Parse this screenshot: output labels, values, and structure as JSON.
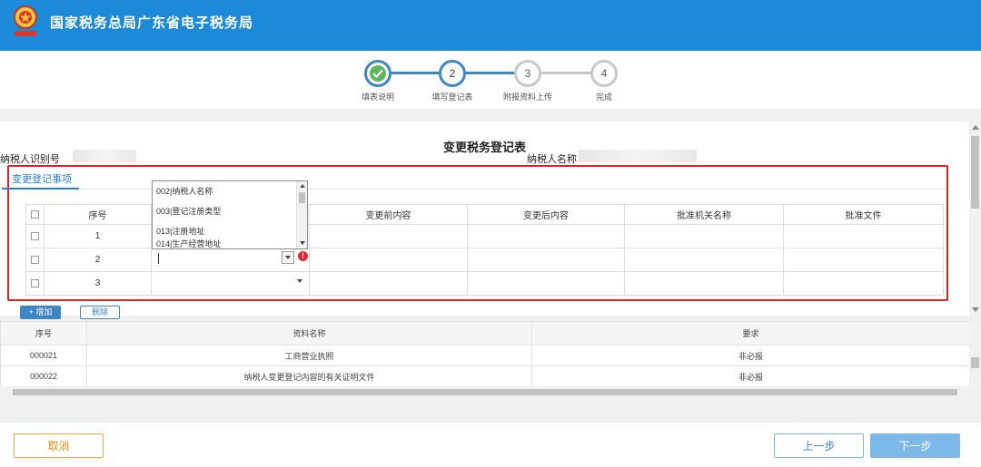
{
  "header": {
    "title": "国家税务总局广东省电子税务局"
  },
  "steps": [
    {
      "number": "1",
      "label": "填表说明",
      "state": "done"
    },
    {
      "number": "2",
      "label": "填写登记表",
      "state": "active"
    },
    {
      "number": "3",
      "label": "附报资料上传",
      "state": "pending"
    },
    {
      "number": "4",
      "label": "完成",
      "state": "pending"
    }
  ],
  "form": {
    "title": "变更税务登记表",
    "taxpayer_id_label": "纳税人识别号",
    "taxpayer_name_label": "纳税人名称"
  },
  "tab": {
    "label": "变更登记事项"
  },
  "reg_table": {
    "headers": [
      "序号",
      "",
      "变更前内容",
      "变更后内容",
      "批准机关名称",
      "批准文件"
    ],
    "rows": [
      "1",
      "2",
      "3"
    ]
  },
  "dropdown": {
    "options": [
      "002|纳税人名称",
      "003|登记注册类型",
      "013|注册地址",
      "014|生产经营地址"
    ]
  },
  "buttons": {
    "add": "+ 增加",
    "delete": "删除",
    "cancel": "取消",
    "prev": "上一步",
    "next": "下一步"
  },
  "attachments": {
    "headers": [
      "序号",
      "资料名称",
      "要求"
    ],
    "rows": [
      {
        "id": "000021",
        "name": "工商营业执照",
        "req": "非必报"
      },
      {
        "id": "000022",
        "name": "纳税人变更登记内容的有关证明文件",
        "req": "非必报"
      }
    ]
  },
  "colors": {
    "header_bg": "#1c8ad8",
    "accent": "#3d86c6",
    "highlight_frame": "#d9262d",
    "cancel": "#f08c10"
  }
}
